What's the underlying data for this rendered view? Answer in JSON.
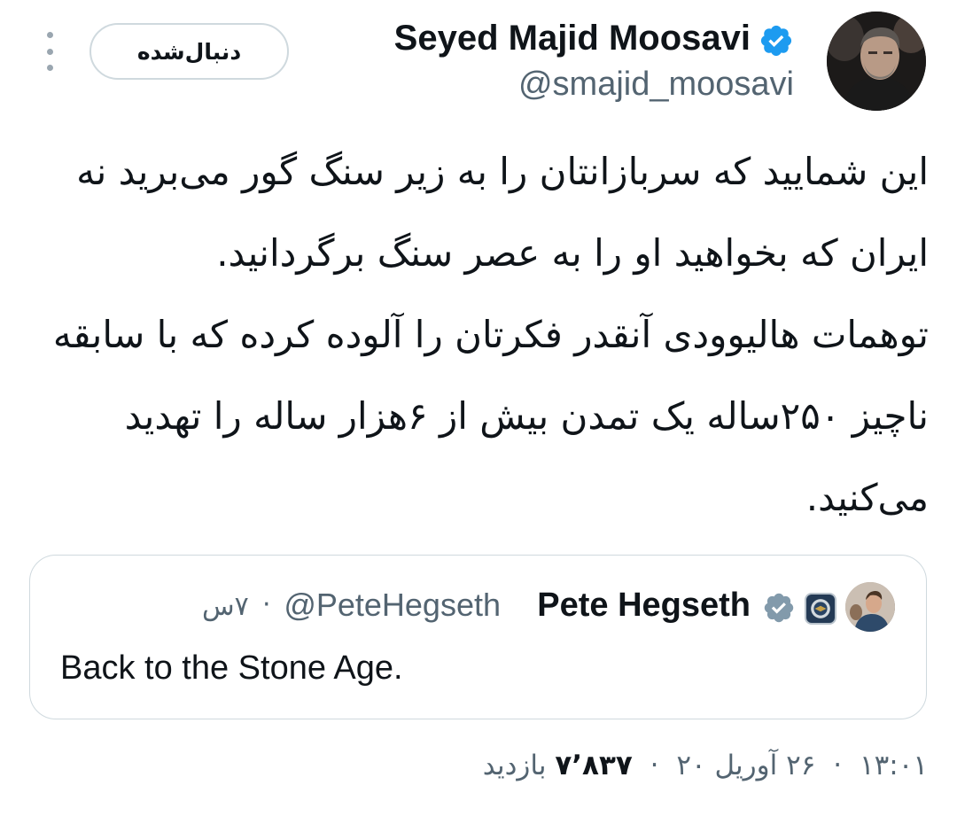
{
  "author": {
    "display_name": "Seyed Majid Moosavi",
    "handle": "@smajid_moosavi",
    "verified_color": "#1d9bf0",
    "follow_label": "دنبال‌شده"
  },
  "tweet": {
    "lines": [
      "این شمایید که سربازانتان را به زیر سنگ گور می‌برید نه",
      "ایران که بخواهید او را به عصر سنگ برگردانید.",
      "توهمات هالیوودی آنقدر فکرتان را آلوده کرده که با سابقه",
      "ناچیز ۲۵۰ساله یک تمدن بیش از ۶هزار ساله را تهدید",
      "می‌کنید."
    ]
  },
  "quoted": {
    "display_name": "Pete Hegseth",
    "handle": "@PeteHegseth",
    "dot": "·",
    "time": "۷س",
    "text": "Back to the Stone Age.",
    "verified_color": "#829aab"
  },
  "meta": {
    "time": "۱۳:۰۱",
    "date": "۲۶ آوریل ۲۰",
    "views_count": "۷٬۸۳۷",
    "views_label": "بازدید",
    "separator": "·"
  },
  "icons": {
    "more": "more-vertical-icon",
    "verified": "verified-badge-icon",
    "org_badge": "dod-seal-icon"
  }
}
